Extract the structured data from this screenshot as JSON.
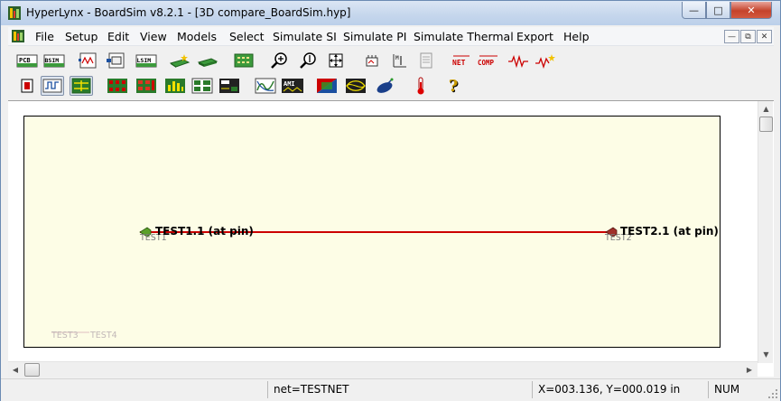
{
  "window": {
    "title": "HyperLynx - BoardSim v8.2.1 - [3D compare_BoardSim.hyp]",
    "minimize_glyph": "—",
    "maximize_glyph": "□",
    "close_glyph": "✕"
  },
  "menu": {
    "items": [
      {
        "label": "File"
      },
      {
        "label": "Setup"
      },
      {
        "label": "Edit"
      },
      {
        "label": "View"
      },
      {
        "label": "Models"
      },
      {
        "label": "Select"
      },
      {
        "label": "Simulate SI"
      },
      {
        "label": "Simulate PI"
      },
      {
        "label": "Simulate Thermal"
      },
      {
        "label": "Export"
      },
      {
        "label": "Help"
      }
    ],
    "mdi_min": "—",
    "mdi_restore": "⧉",
    "mdi_close": "✕"
  },
  "toolbar1": {
    "pcb_label": "PCB",
    "bsim_label": "BSIM",
    "lsim_label": "LSIM",
    "net_label": "NET",
    "comp_label": "COMP"
  },
  "toolbar2": {
    "ami_label": "AMI",
    "help_glyph": "?"
  },
  "board": {
    "net_color": "#cc0000",
    "pin_labels": {
      "left": "TEST1.1 (at pin)",
      "right": "TEST2.1 (at pin)"
    },
    "ref_labels": {
      "left": "TEST1",
      "right": "TEST2"
    },
    "faint_labels": {
      "a": "TEST3",
      "b": "TEST4"
    }
  },
  "status": {
    "net": "net=TESTNET",
    "coords": "X=003.136, Y=000.019 in",
    "numlock": "NUM"
  }
}
